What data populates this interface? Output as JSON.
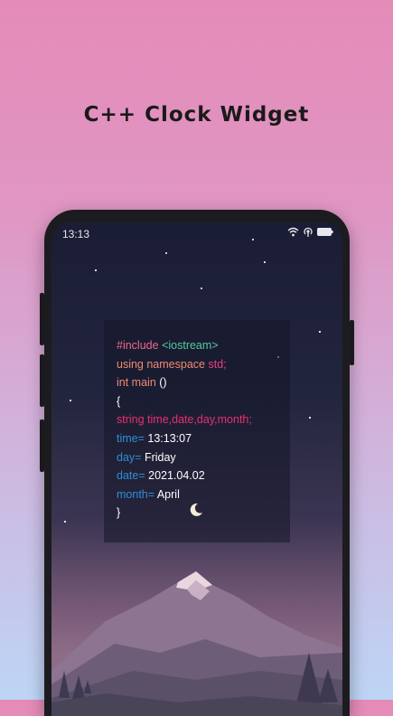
{
  "promo": {
    "title": "C++ Clock Widget"
  },
  "status_bar": {
    "time": "13:13"
  },
  "widget": {
    "include_kw": "#include",
    "include_lib": "<iostream>",
    "using_kw": "using namespace",
    "using_std": "std;",
    "int_kw": "int main",
    "int_paren": "()",
    "open_brace": "{",
    "string_decl": "string time,date,day,month;",
    "time_label": "time=",
    "time_value": "13:13:07",
    "day_label": "day=",
    "day_value": "Friday",
    "date_label": "date=",
    "date_value": "2021.04.02",
    "month_label": "month=",
    "month_value": "April",
    "close_brace": "}"
  },
  "icons": [
    "wifi-icon",
    "hotspot-icon",
    "battery-icon",
    "moon-icon"
  ],
  "colors": {
    "background_top": "#e58bb8",
    "background_bottom": "#bdd5f5",
    "phone_frame": "#1c1c20",
    "keyword_green": "#54c9a0",
    "keyword_pink": "#e83070",
    "variable_blue": "#2e8fd6"
  }
}
